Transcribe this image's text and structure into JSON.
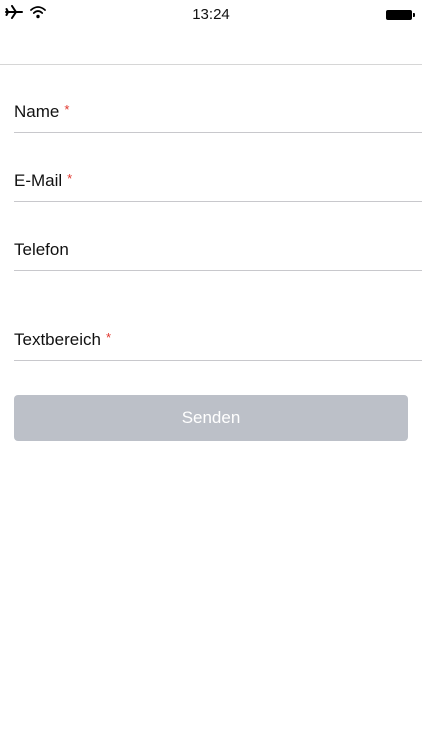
{
  "status_bar": {
    "time": "13:24",
    "icons": [
      "airplane-icon",
      "wifi-icon",
      "battery-icon"
    ]
  },
  "form": {
    "fields": [
      {
        "label": "Name",
        "required_marker": "*"
      },
      {
        "label": "E-Mail",
        "required_marker": "*"
      },
      {
        "label": "Telefon",
        "required_marker": ""
      },
      {
        "label": "Textbereich",
        "required_marker": "*"
      }
    ],
    "submit_label": "Senden"
  },
  "colors": {
    "required_marker": "#e0342b",
    "button_disabled": "#bcc0c8",
    "divider": "#c8c8cc"
  }
}
